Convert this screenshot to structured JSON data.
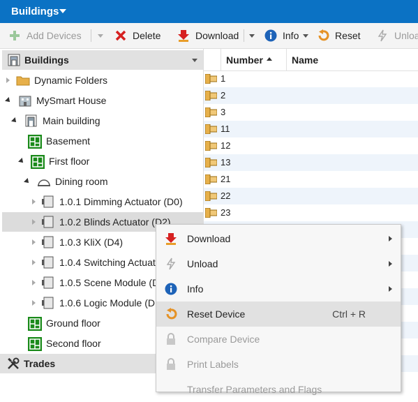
{
  "titlebar": {
    "title": "Buildings"
  },
  "toolbar": {
    "add_devices": "Add Devices",
    "delete": "Delete",
    "download": "Download",
    "info": "Info",
    "reset": "Reset",
    "unload": "Unloa"
  },
  "tree": {
    "header": "Buildings",
    "nodes": [
      {
        "label": "Dynamic Folders"
      },
      {
        "label": "MySmart House"
      },
      {
        "label": "Main building"
      },
      {
        "label": "Basement"
      },
      {
        "label": "First floor"
      },
      {
        "label": "Dining room"
      },
      {
        "label": "1.0.1 Dimming Actuator (D0)"
      },
      {
        "label": "1.0.2 Blinds Actuator (D2)"
      },
      {
        "label": "1.0.3 KliX (D4)"
      },
      {
        "label": "1.0.4 Switching Actuat"
      },
      {
        "label": "1.0.5 Scene Module (D"
      },
      {
        "label": "1.0.6 Logic Module (D"
      },
      {
        "label": "Ground floor"
      },
      {
        "label": "Second floor"
      }
    ],
    "bottom": "Trades"
  },
  "list": {
    "col_number": "Number",
    "col_name": "Name",
    "rows": [
      "1",
      "2",
      "3",
      "11",
      "12",
      "13",
      "21",
      "22",
      "23"
    ]
  },
  "context_menu": {
    "items": [
      {
        "label": "Download"
      },
      {
        "label": "Unload"
      },
      {
        "label": "Info"
      },
      {
        "label": "Reset Device",
        "shortcut": "Ctrl + R"
      },
      {
        "label": "Compare Device"
      },
      {
        "label": "Print Labels"
      },
      {
        "label": "Transfer Parameters and Flags"
      }
    ]
  },
  "colors": {
    "accent": "#0b72c4",
    "folder": "#e7b04a",
    "green": "#1a8a1a",
    "red": "#d62020"
  }
}
